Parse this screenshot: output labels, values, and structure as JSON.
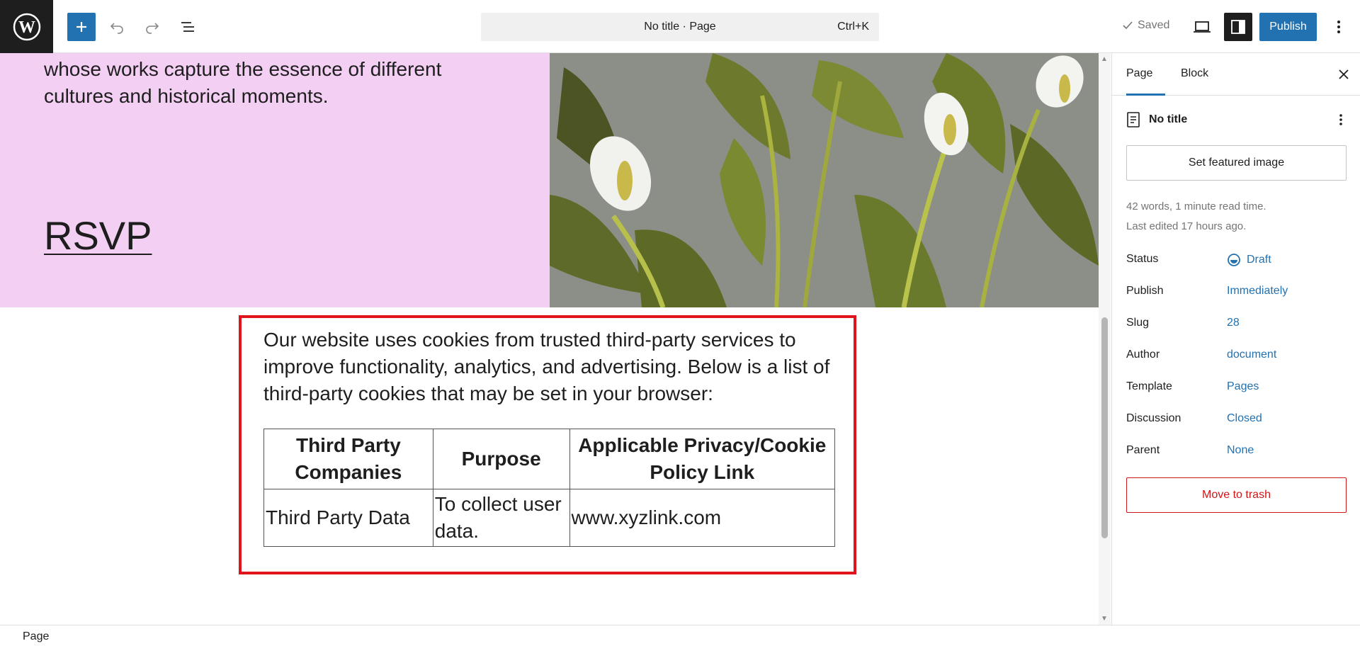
{
  "topbar": {
    "command_title": "No title · Page",
    "command_shortcut": "Ctrl+K",
    "saved_label": "Saved",
    "publish_label": "Publish"
  },
  "canvas": {
    "cover_text": "whose works capture the essence of different cultures and historical moments.",
    "cover_link": "RSVP",
    "cookie_paragraph": "Our website uses cookies from trusted third-party services to improve functionality, analytics, and advertising. Below is a list of third-party cookies that may be set in your browser:",
    "table": {
      "headers": [
        "Third Party Companies",
        "Purpose",
        "Applicable Privacy/Cookie Policy Link"
      ],
      "rows": [
        [
          "Third Party Data",
          "To collect user data.",
          "www.xyzlink.com"
        ]
      ]
    }
  },
  "sidebar": {
    "tabs": [
      "Page",
      "Block"
    ],
    "post_title": "No title",
    "featured_image_label": "Set featured image",
    "word_count": "42 words, 1 minute read time.",
    "last_edited": "Last edited 17 hours ago.",
    "fields": [
      {
        "label": "Status",
        "value": "Draft"
      },
      {
        "label": "Publish",
        "value": "Immediately"
      },
      {
        "label": "Slug",
        "value": "28"
      },
      {
        "label": "Author",
        "value": "document"
      },
      {
        "label": "Template",
        "value": "Pages"
      },
      {
        "label": "Discussion",
        "value": "Closed"
      },
      {
        "label": "Parent",
        "value": "None"
      }
    ],
    "trash_label": "Move to trash"
  },
  "footer": {
    "breadcrumb": "Page"
  },
  "colors": {
    "accent": "#2271b1",
    "cover_bg": "#f3cff3",
    "highlight": "#e0141b",
    "danger": "#cc1818"
  }
}
